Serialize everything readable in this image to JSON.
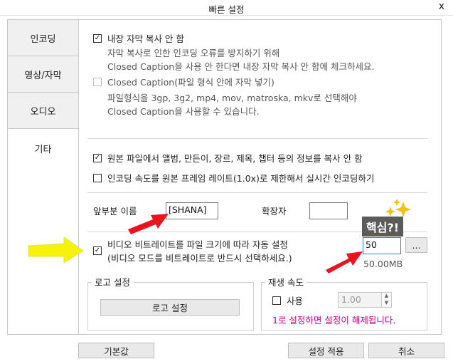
{
  "window": {
    "title": "빠른 설정",
    "close": "x"
  },
  "tabs": [
    {
      "label": "인코딩"
    },
    {
      "label": "영상/자막"
    },
    {
      "label": "오디오"
    },
    {
      "label": "기타"
    }
  ],
  "options": {
    "copy_subtitle": {
      "label": "내장 자막 복사 안 함",
      "desc1": "자막 복사로 인한 인코딩 오류를 방지하기 위해",
      "desc2": "Closed Caption을 사용 안 한다면 내장 자막 복사 안 함에 체크하세요.",
      "checked": true
    },
    "closed_caption": {
      "label": "Closed Caption(파일 형식 안에 자막 넣기)",
      "desc1": "파일형식을 3gp, 3g2, mp4, mov, matroska, mkv로 선택해야",
      "desc2": "Closed Caption을 사용할 수 있습니다.",
      "checked": false
    },
    "no_copy_info": {
      "label": "원본 파일에서 앨범, 만든이, 장르, 제목, 챕터 등의 정보를 복사 안 함",
      "checked": true
    },
    "limit_speed": {
      "label": "인코딩 속도를 원본 프레임 레이트(1.0x)로 제한해서 실시간 인코딩하기",
      "checked": false
    }
  },
  "filename": {
    "prefix_label": "앞부분 이름",
    "prefix_value": "[SHANA]",
    "ext_label": "확장자",
    "ext_value": ""
  },
  "bitrate": {
    "label1": "비디오 비트레이트를 파일 크기에 따라 자동 설정",
    "label2": "(비디오 모드를 비트레이트로 반드시 선택하세요.)",
    "checked": true,
    "value": "50",
    "browse": "...",
    "size": "50.00MB",
    "badge": "핵심?!"
  },
  "logo": {
    "group_title": "로고 설정",
    "button": "로고 설정"
  },
  "playback": {
    "group_title": "재생 속도",
    "use_label": "사용",
    "use_checked": false,
    "speed": "1.00",
    "note": "1로 설정하면 설정이 해제됩니다."
  },
  "footer": {
    "default": "기본값",
    "apply": "설정 적용",
    "cancel": "취소"
  },
  "colors": {
    "accent_pink": "#d6008a",
    "arrow_red": "#e8141e",
    "arrow_yellow": "#f6f20a"
  }
}
